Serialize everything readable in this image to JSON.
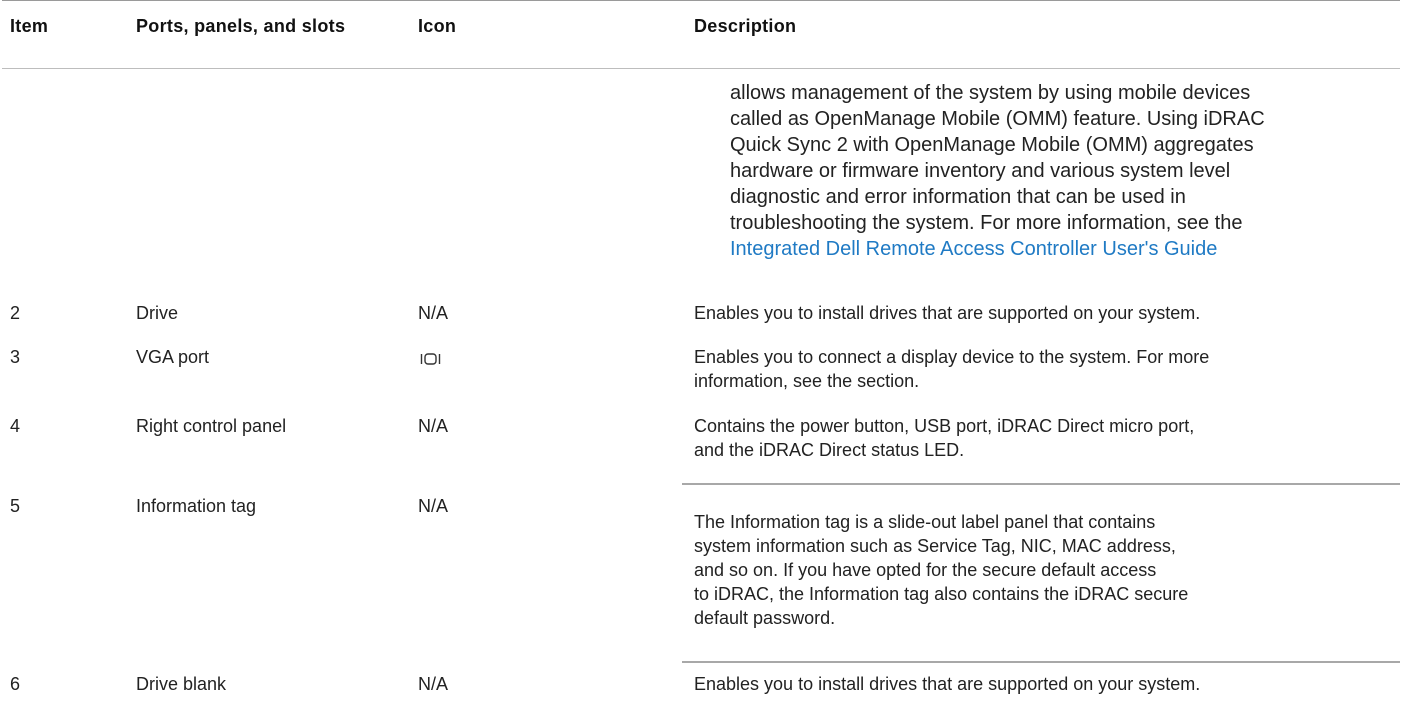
{
  "table": {
    "headers": {
      "item": "Item",
      "ports": "Ports, panels, and slots",
      "icon": "Icon",
      "description": "Description"
    },
    "continued_description": {
      "lines": [
        "allows management of the system by using mobile devices",
        "called as OpenManage Mobile (OMM) feature. Using iDRAC",
        "Quick Sync 2 with OpenManage Mobile (OMM) aggregates",
        "hardware or firmware inventory and various system level",
        "diagnostic and error information that can be used in",
        "troubleshooting the system. For more information, see the"
      ],
      "link": "Integrated Dell Remote Access Controller User's Guide"
    },
    "rows": [
      {
        "item": "2",
        "ports": "Drive",
        "icon": "N/A",
        "description": [
          "Enables you to install drives that are supported on your system."
        ]
      },
      {
        "item": "3",
        "ports": "VGA port",
        "icon": "vga-port-icon",
        "description": [
          "Enables you to connect a display device to the system. For more",
          "information, see the section."
        ]
      },
      {
        "item": "4",
        "ports": "Right control panel",
        "icon": "N/A",
        "description": [
          "Contains the power button, USB port, iDRAC Direct micro port,",
          "and the iDRAC Direct status LED."
        ]
      },
      {
        "item": "5",
        "ports": "Information tag",
        "icon": "N/A",
        "description": [
          "The Information tag is a slide-out label panel that contains",
          "system information such as Service Tag, NIC, MAC address,",
          "and so on. If you have opted for the secure default access",
          "to iDRAC, the Information tag also contains the iDRAC secure",
          "default password."
        ]
      },
      {
        "item": "6",
        "ports": "Drive blank",
        "icon": "N/A",
        "description": [
          "Enables you to install drives that are supported on your system."
        ]
      }
    ]
  },
  "colors": {
    "link": "#1f7ac4",
    "text": "#222222",
    "rule": "#a8a8a8"
  }
}
